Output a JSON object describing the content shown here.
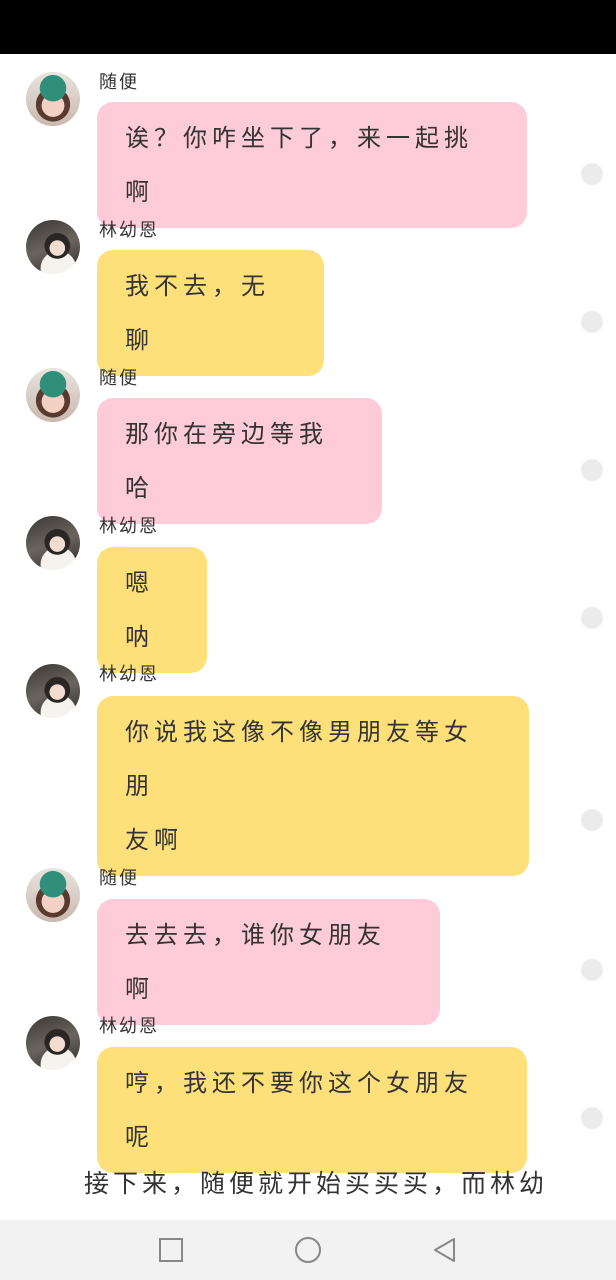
{
  "messages": [
    {
      "sender": "随便",
      "text": "诶？你咋坐下了，来一起挑啊",
      "style": "pink"
    },
    {
      "sender": "林幼恩",
      "text": "我不去，无聊",
      "style": "yellow"
    },
    {
      "sender": "随便",
      "text": "那你在旁边等我哈",
      "style": "pink"
    },
    {
      "sender": "林幼恩",
      "text": "嗯呐",
      "style": "yellow"
    },
    {
      "sender": "林幼恩",
      "text_line1": "你说我这像不像男朋友等女朋",
      "text_line2": "友啊",
      "style": "yellow"
    },
    {
      "sender": "随便",
      "text": "去去去，谁你女朋友啊",
      "style": "pink"
    },
    {
      "sender": "林幼恩",
      "text": "哼，我还不要你这个女朋友呢",
      "style": "yellow"
    }
  ],
  "narration": "接下来，随便就开始买买买，而林幼",
  "colors": {
    "pink_bubble": "#fecbd8",
    "yellow_bubble": "#fee07a",
    "status_bar": "#000000",
    "nav_bar": "#f2f2f2"
  },
  "nav": {
    "icons": [
      "recent-apps-icon",
      "home-icon",
      "back-icon"
    ]
  }
}
